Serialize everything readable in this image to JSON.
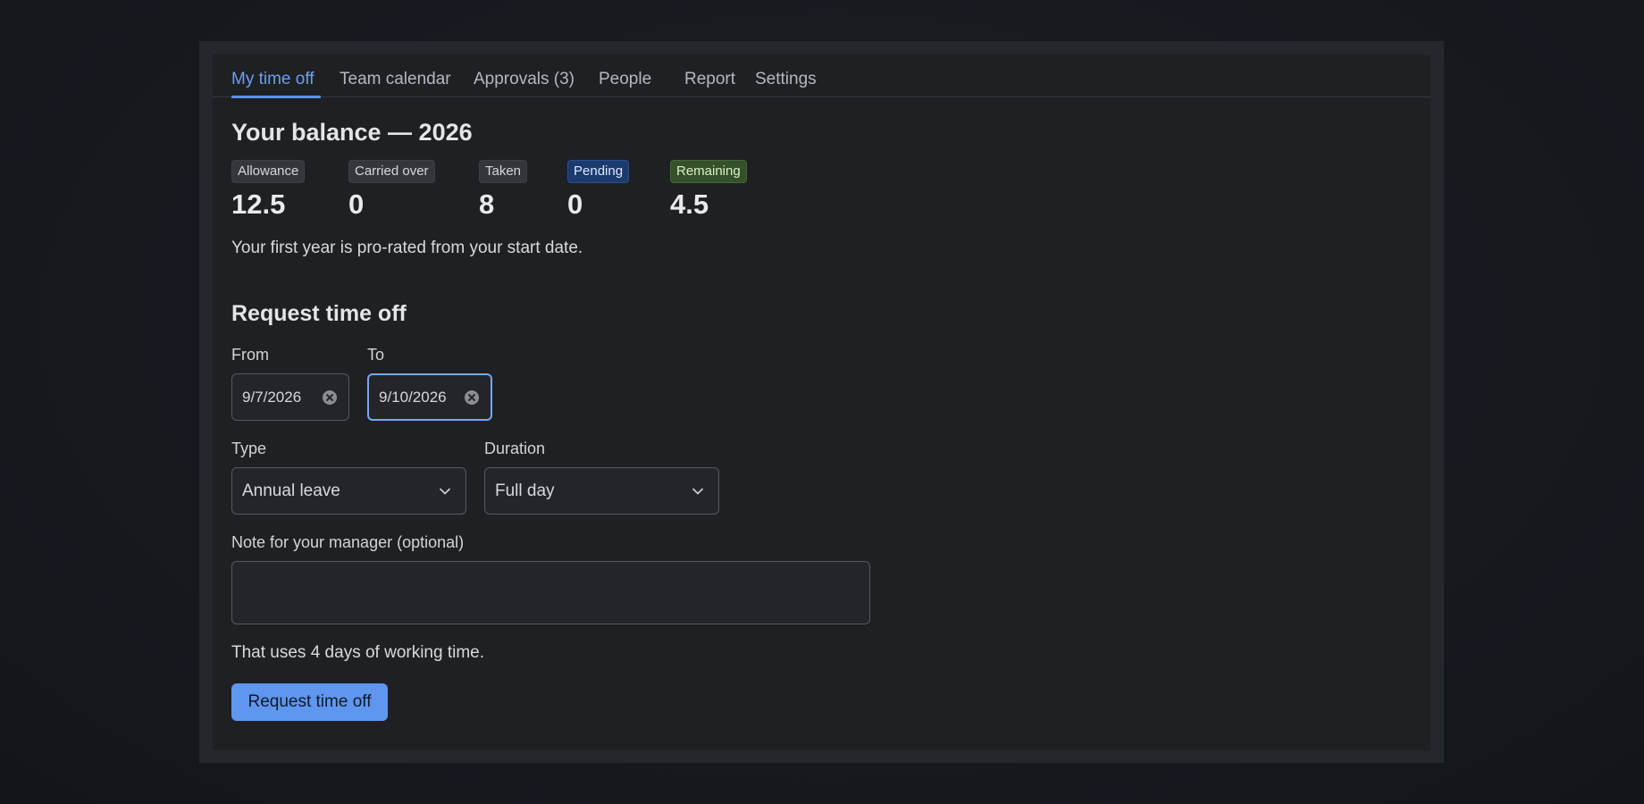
{
  "tabs": [
    {
      "label": "My time off",
      "active": true
    },
    {
      "label": "Team calendar",
      "active": false
    },
    {
      "label": "Approvals (3)",
      "active": false
    },
    {
      "label": "People",
      "active": false
    },
    {
      "label": "Report",
      "active": false
    },
    {
      "label": "Settings",
      "active": false
    }
  ],
  "balance": {
    "title": "Your balance — 2026",
    "stats": [
      {
        "label": "Allowance",
        "value": "12.5"
      },
      {
        "label": "Carried over",
        "value": "0"
      },
      {
        "label": "Taken",
        "value": "8"
      },
      {
        "label": "Pending",
        "value": "0"
      },
      {
        "label": "Remaining",
        "value": "4.5"
      }
    ],
    "note": "Your first year is pro-rated from your start date."
  },
  "request": {
    "title": "Request time off",
    "from_label": "From",
    "from_value": "9/7/2026",
    "to_label": "To",
    "to_value": "9/10/2026",
    "type_label": "Type",
    "type_value": "Annual leave",
    "duration_label": "Duration",
    "duration_value": "Full day",
    "note_label": "Note for your manager (optional)",
    "note_value": "",
    "summary": "That uses 4 days of working time.",
    "submit_label": "Request time off"
  },
  "colors": {
    "accent": "#5f97ee",
    "pending_badge": "#1b3a6e",
    "remaining_badge": "#35502a"
  }
}
